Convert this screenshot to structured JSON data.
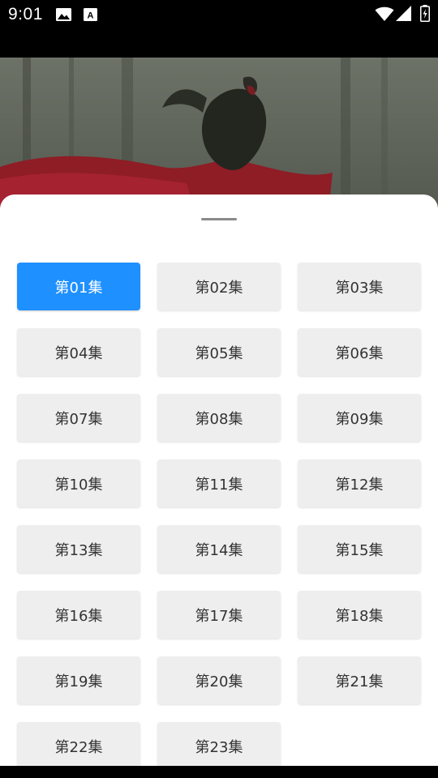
{
  "status_bar": {
    "time": "9:01",
    "icons": [
      "image-icon",
      "text-a-icon",
      "wifi-icon",
      "cell-signal-icon",
      "battery-icon"
    ]
  },
  "colors": {
    "active": "#1e90ff",
    "inactive_bg": "#eeeeee",
    "text": "#333333"
  },
  "episodes": [
    {
      "label": "第01集",
      "active": true
    },
    {
      "label": "第02集"
    },
    {
      "label": "第03集"
    },
    {
      "label": "第04集"
    },
    {
      "label": "第05集"
    },
    {
      "label": "第06集"
    },
    {
      "label": "第07集"
    },
    {
      "label": "第08集"
    },
    {
      "label": "第09集"
    },
    {
      "label": "第10集"
    },
    {
      "label": "第11集"
    },
    {
      "label": "第12集"
    },
    {
      "label": "第13集"
    },
    {
      "label": "第14集"
    },
    {
      "label": "第15集"
    },
    {
      "label": "第16集"
    },
    {
      "label": "第17集"
    },
    {
      "label": "第18集"
    },
    {
      "label": "第19集"
    },
    {
      "label": "第20集"
    },
    {
      "label": "第21集"
    },
    {
      "label": "第22集"
    },
    {
      "label": "第23集"
    }
  ]
}
